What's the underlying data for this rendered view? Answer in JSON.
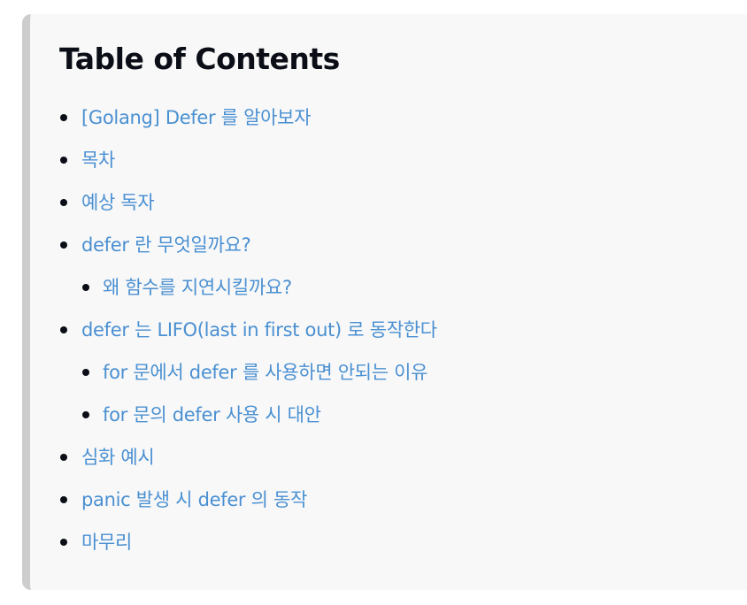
{
  "toc": {
    "title": "Table of Contents",
    "items": [
      {
        "label": "[Golang] Defer 를 알아보자",
        "level": 1
      },
      {
        "label": "목차",
        "level": 1
      },
      {
        "label": "예상 독자",
        "level": 1
      },
      {
        "label": "defer 란 무엇일까요?",
        "level": 1
      },
      {
        "label": "왜 함수를 지연시킬까요?",
        "level": 2
      },
      {
        "label": "defer 는 LIFO(last in first out) 로 동작한다",
        "level": 1
      },
      {
        "label": "for 문에서 defer 를 사용하면 안되는 이유",
        "level": 2
      },
      {
        "label": "for 문의 defer 사용 시 대안",
        "level": 2
      },
      {
        "label": "심화 예시",
        "level": 1
      },
      {
        "label": "panic 발생 시 defer 의 동작",
        "level": 1
      },
      {
        "label": "마무리",
        "level": 1
      }
    ]
  },
  "colors": {
    "link": "#4a90d2",
    "title": "#0b0e16",
    "background": "#f8f8f8",
    "border": "#cdcdcd"
  }
}
